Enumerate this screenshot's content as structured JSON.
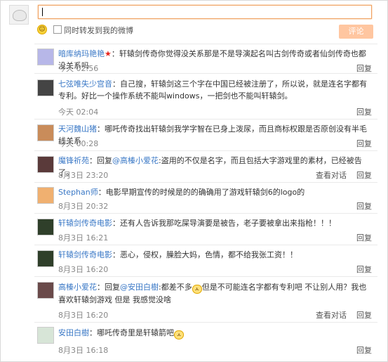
{
  "composer": {
    "input_value": "",
    "repost_label": "同时转发到我的微博",
    "submit_label": "评论"
  },
  "actions": {
    "reply_label": "回复",
    "view_conversation_label": "查看对话"
  },
  "comments": [
    {
      "user": "暗库纳玛艳艳",
      "badge": "★",
      "text": "：轩辕剑传奇你觉得没关系那是不是导演起名叫古剑传奇或者仙剑传奇也都没关系吗",
      "time": "今天 02:56"
    },
    {
      "user": "七弦唯失少宫音",
      "text": "：自己搜，轩辕剑这三个字在中国已经被注册了，所以说，就是连名字都有专利。好比一个操作系统不能叫windows，一把剑也不能叫轩辕剑。",
      "time": "今天 02:04"
    },
    {
      "user": "天河魏山猪",
      "text": "：哪吒传奇找出轩辕剑我学字智在已身上泼尿，而且商标权跟是否原创没有半毛线关系",
      "time": "今天 00:28"
    },
    {
      "user": "魔锋祈苑",
      "text_prefix": "：回复",
      "mention": "@高榛小爱花",
      "text": ":盗用的不仅是名字，而且包括大字游戏里的素材，已经被告了。",
      "time": "8月3日 23:20",
      "has_view": true
    },
    {
      "user": "Stephan师",
      "text": "：电影早期宣传的时候是的的确确用了游戏轩辕剑6的logo的",
      "time": "8月3日 20:32"
    },
    {
      "user": "轩辕剑传奇电影",
      "text": "：还有人告诉我那吃屎导演要是被告，老子要被拿出来指枪！！！",
      "time": "8月3日 16:21"
    },
    {
      "user": "轩辕剑传奇电影",
      "text": "：恶心，侵权，臊脸大妈，色情，都不给我张工资！！",
      "time": "8月3日 16:20"
    },
    {
      "user": "高榛小爱花",
      "text_prefix": "：回复",
      "mention": "@安田白樹",
      "text": ":都差不多",
      "text_after": "但是不可能连名字都有专利吧 不让别人用？我也喜欢轩辕剑游戏 但是 我感觉没啥",
      "time": "8月3日 16:20",
      "has_view": true
    },
    {
      "user": "安田白樹",
      "text": "：哪吒传奇里是轩辕箭吧",
      "time": "8月3日 16:18",
      "has_face": true
    }
  ]
}
